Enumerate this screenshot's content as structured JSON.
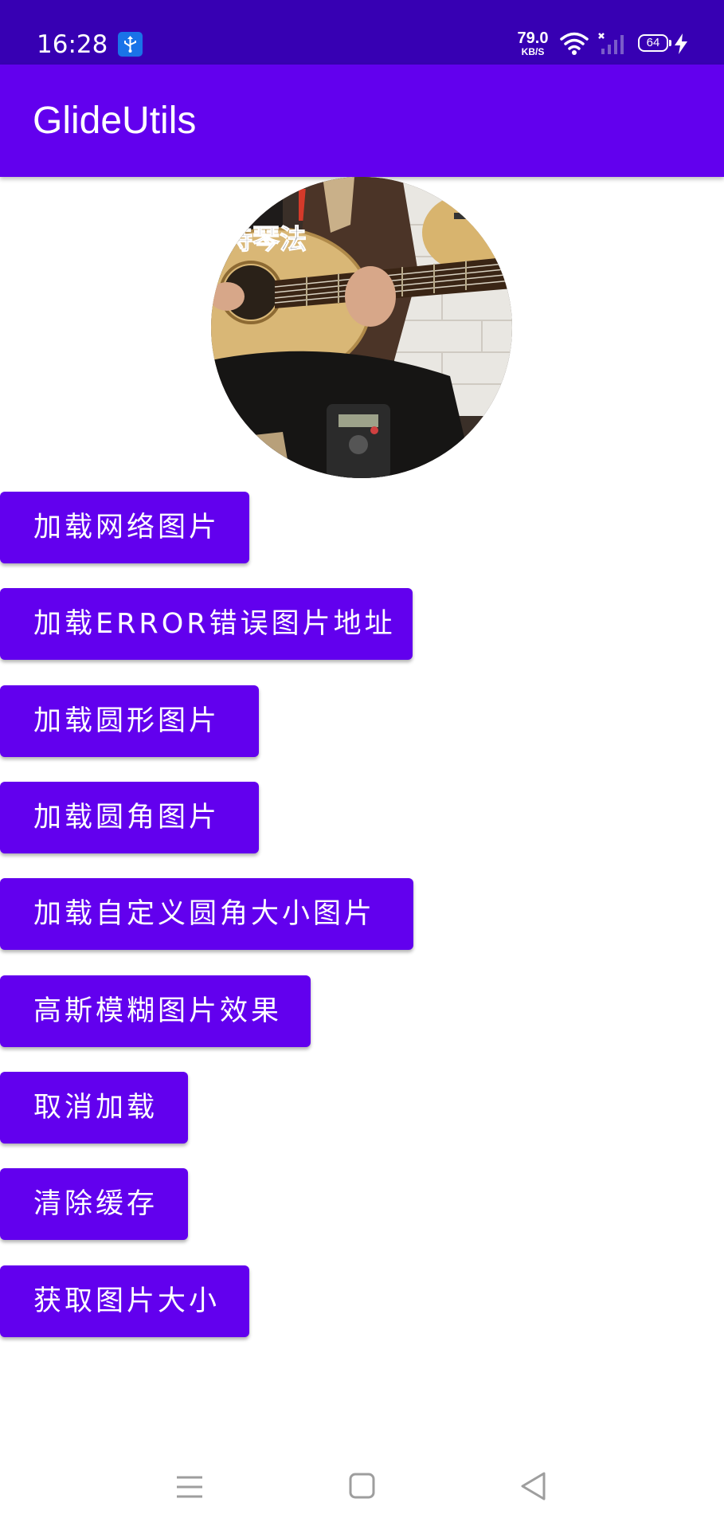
{
  "status_bar": {
    "time": "16:28",
    "net_speed_value": "79.0",
    "net_speed_unit": "KB/S",
    "battery": "64",
    "icons": [
      "usb-icon",
      "wifi-icon",
      "signal-icon",
      "battery-icon",
      "charging-icon"
    ]
  },
  "app_bar": {
    "title": "GlideUtils"
  },
  "image": {
    "overlay_text": "持琴法"
  },
  "buttons": [
    "加载网络图片",
    "加载ERROR错误图片地址",
    "加载圆形图片",
    "加载圆角图片",
    "加载自定义圆角大小图片",
    "高斯模糊图片效果",
    "取消加载",
    "清除缓存",
    "获取图片大小"
  ],
  "colors": {
    "status_bar": "#3700b3",
    "primary": "#6200ee",
    "on_primary": "#ffffff",
    "nav_icons": "#9e9e9e"
  },
  "nav_bar": {
    "icons": [
      "menu-icon",
      "home-icon",
      "back-icon"
    ]
  }
}
